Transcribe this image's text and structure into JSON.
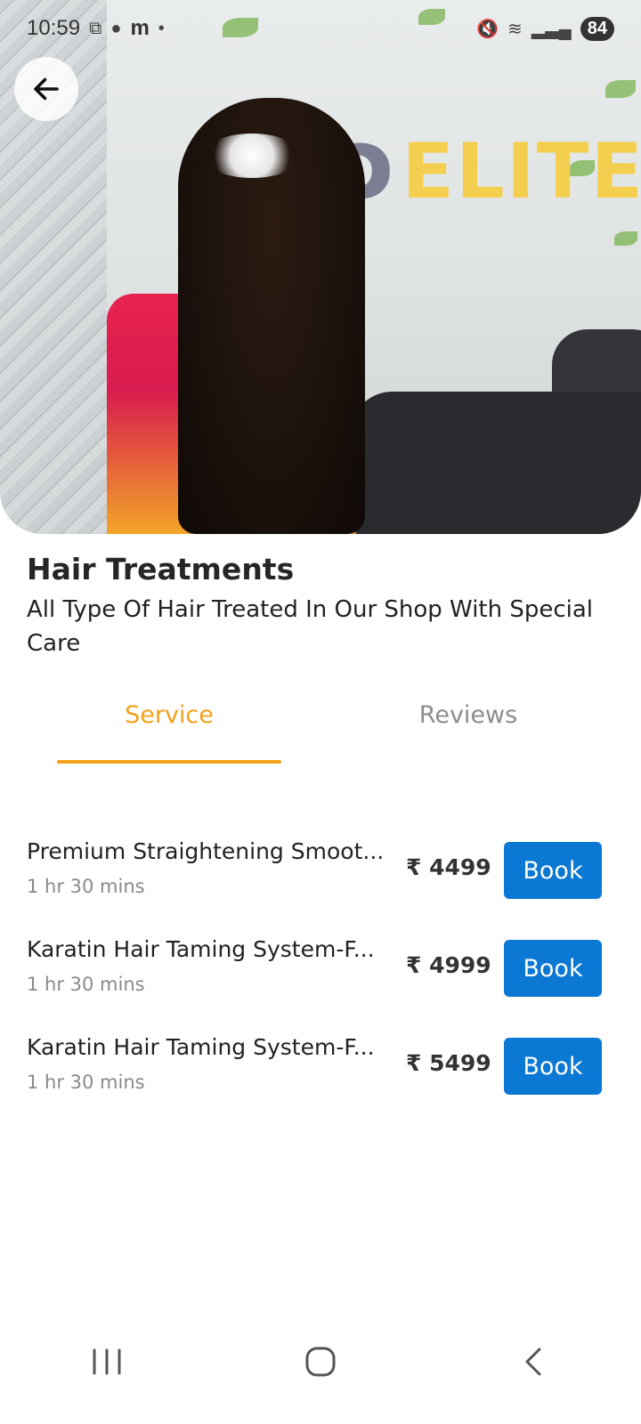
{
  "status_bar": {
    "time": "10:59",
    "left_glyph": "m",
    "battery": "84"
  },
  "header": {
    "title": "Hair Treatments",
    "description": "All Type Of Hair Treated In Our Shop With Special Care"
  },
  "hero": {
    "logo_text": "ELITE"
  },
  "tabs": [
    {
      "label": "Service",
      "active": true
    },
    {
      "label": "Reviews",
      "active": false
    }
  ],
  "colors": {
    "accent": "#f2a11b",
    "primary_button": "#0b78d4"
  },
  "services": [
    {
      "name": "Premium Straightening Smoot...",
      "duration": "1 hr 30 mins",
      "price": "₹ 4499",
      "button": "Book"
    },
    {
      "name": "Karatin Hair Taming System-F...",
      "duration": "1 hr 30 mins",
      "price": "₹ 4999",
      "button": "Book"
    },
    {
      "name": "Karatin Hair Taming System-F...",
      "duration": "1 hr 30 mins",
      "price": "₹ 5499",
      "button": "Book"
    }
  ]
}
